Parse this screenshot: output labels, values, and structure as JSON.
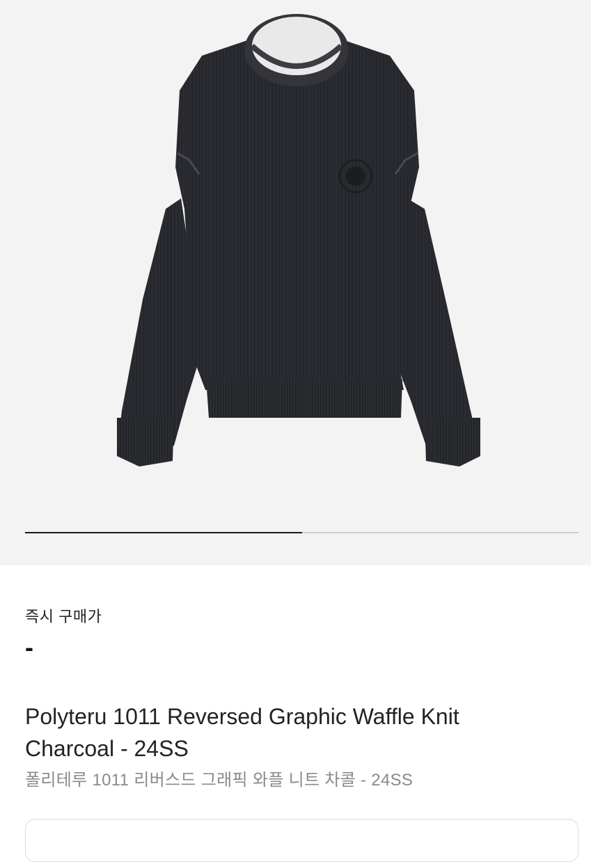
{
  "gallery": {
    "image_alt": "Polyteru 1011 Reversed Graphic Waffle Knit Charcoal",
    "progress": 0.5,
    "colors": {
      "track": "#cfcfcf",
      "fill": "#1a1a1a",
      "background": "#f3f3f3"
    }
  },
  "price": {
    "label": "즉시 구매가",
    "value": "-"
  },
  "product": {
    "title_en": "Polyteru 1011 Reversed Graphic Waffle Knit Charcoal - 24SS",
    "title_ko": "폴리테루 1011 리버스드 그래픽 와플 니트 차콜 - 24SS",
    "color": "#2a2b30"
  }
}
